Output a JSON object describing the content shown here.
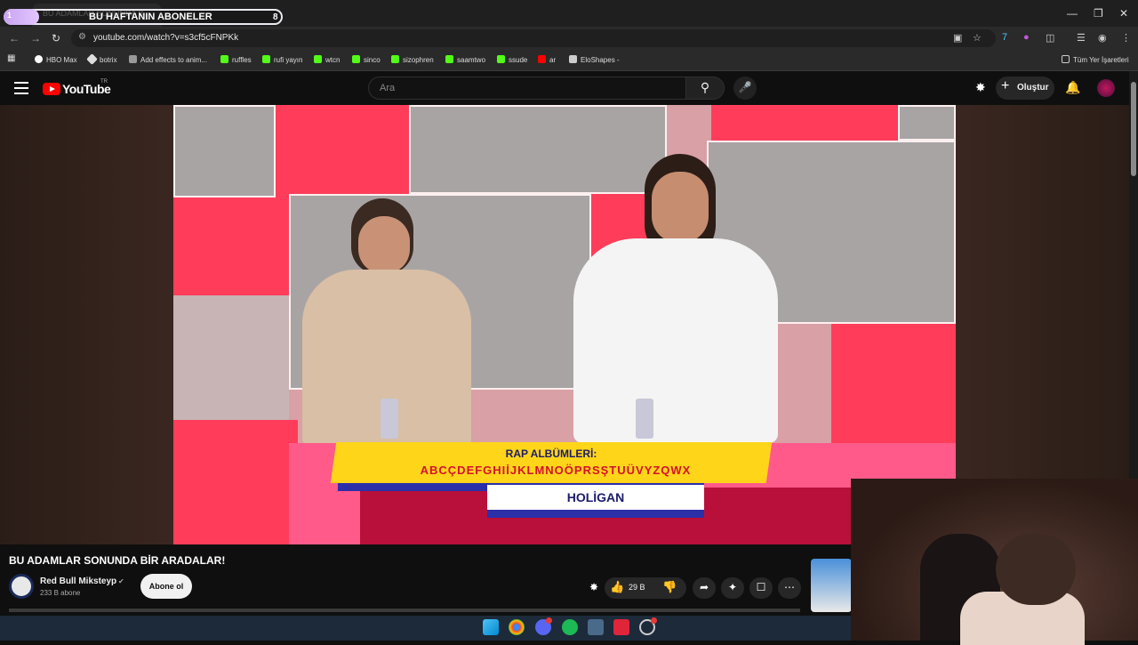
{
  "browser": {
    "tab_title": "BU ADAMLAR SONUNDA B",
    "overlay": {
      "left_number": "1",
      "title": "BU HAFTANIN ABONELER",
      "right_number": "8"
    },
    "url": "youtube.com/watch?v=s3cf5cFNPKk",
    "bookmarks": [
      "HBO Max",
      "botrix",
      "Add effects to anim...",
      "ruffles",
      "rufi yayın",
      "wtcn",
      "sinco",
      "sizophren",
      "saamtwo",
      "ssude",
      "ar",
      "EloShapes -"
    ],
    "bookmarks_folder": "Tüm Yer İşaretleri"
  },
  "youtube": {
    "logo_text": "YouTube",
    "region": "TR",
    "search_placeholder": "Ara",
    "create_label": "Oluştur"
  },
  "video": {
    "title": "BU ADAMLAR SONUNDA BİR ARADALAR!",
    "channel_name": "Red Bull Miksteyp",
    "subscribers": "233 B abone",
    "subscribe_label": "Abone ol",
    "likes": "29 B",
    "overlay_title": "RAP ALBÜMLERİ:",
    "overlay_letters": "ABCÇDEFGHIİJKLMNOÖPRSŞTUÜVYZQWX",
    "overlay_answer": "HOLİGAN"
  },
  "colors": {
    "youtube_red": "#ff0000",
    "banner_yellow": "#ffd51a",
    "banner_blue": "#2b2fa8",
    "letter_red": "#d4112c"
  }
}
